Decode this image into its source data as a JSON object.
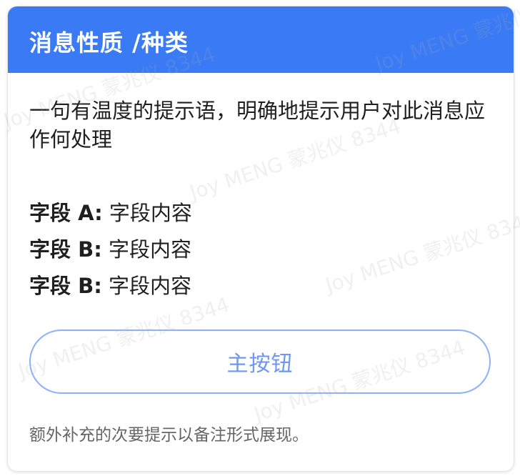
{
  "card": {
    "title": "消息性质 /种类",
    "message": "一句有温度的提示语，明确地提示用户对此消息应作何处理",
    "fields": [
      {
        "label": "字段 A:",
        "value": " 字段内容"
      },
      {
        "label": "字段 B:",
        "value": " 字段内容"
      },
      {
        "label": "字段 B:",
        "value": " 字段内容"
      }
    ],
    "primary_button": "主按钮",
    "note": "额外补充的次要提示以备注形式展现。"
  },
  "watermark": {
    "text": "Joy MENG 蒙兆仪 8344"
  },
  "colors": {
    "header_bg": "#3a7bf5",
    "button_border": "#8fb1f9",
    "button_text": "#6d97f4"
  }
}
